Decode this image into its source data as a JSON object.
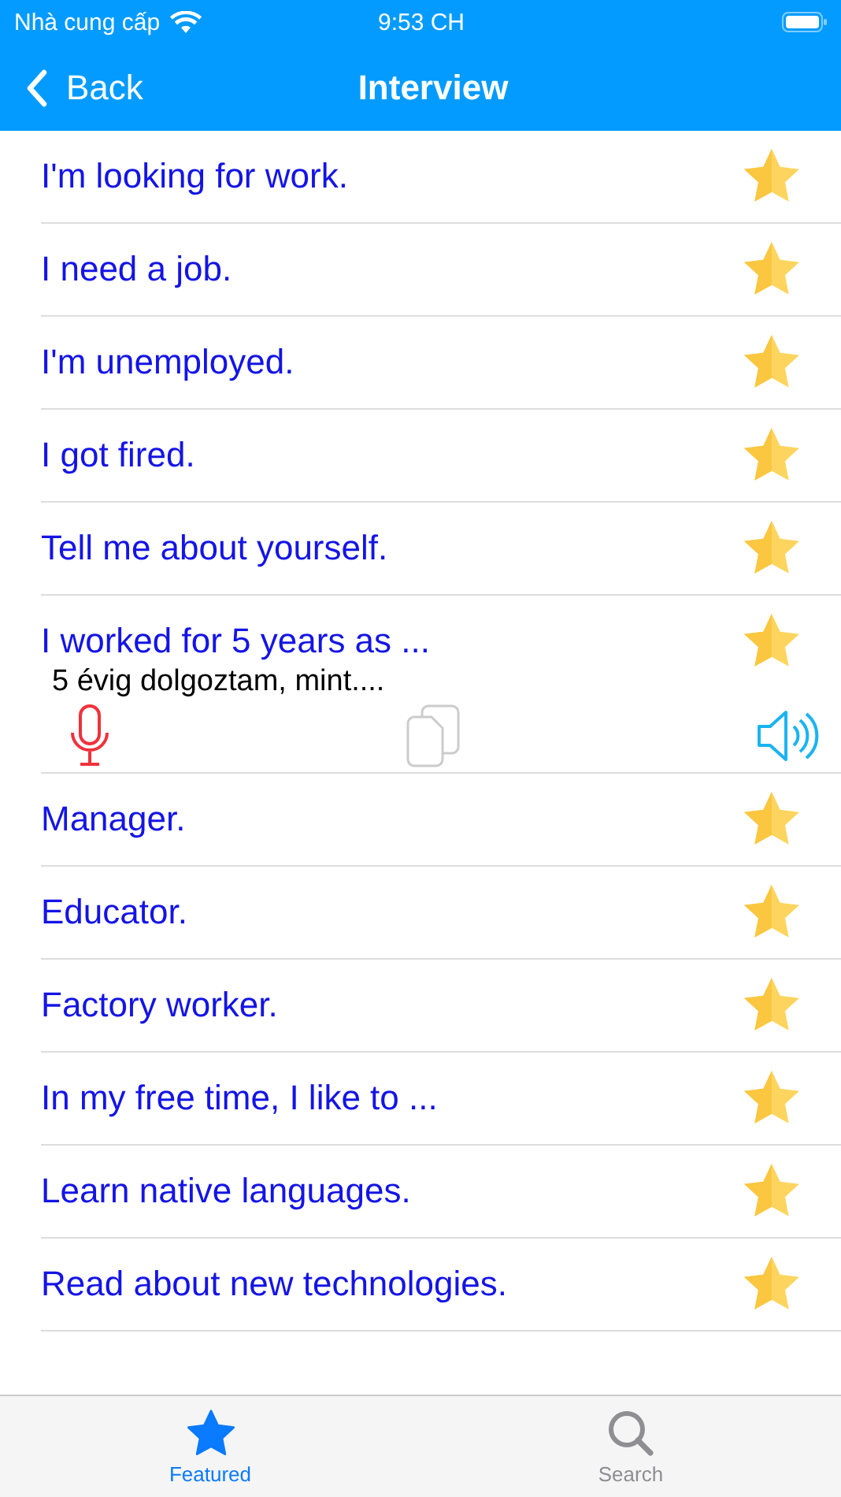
{
  "status_bar": {
    "carrier": "Nhà cung cấp",
    "time": "9:53 CH"
  },
  "nav": {
    "back": "Back",
    "title": "Interview"
  },
  "phrases": [
    {
      "text": "I'm looking for work.",
      "expanded": false
    },
    {
      "text": "I need a job.",
      "expanded": false
    },
    {
      "text": "I'm unemployed.",
      "expanded": false
    },
    {
      "text": "I got fired.",
      "expanded": false
    },
    {
      "text": "Tell me about yourself.",
      "expanded": false
    },
    {
      "text": "I worked for 5 years as ...",
      "expanded": true,
      "translation": "5 évig dolgoztam, mint...."
    },
    {
      "text": "Manager.",
      "expanded": false
    },
    {
      "text": "Educator.",
      "expanded": false
    },
    {
      "text": "Factory worker.",
      "expanded": false
    },
    {
      "text": "In my free time, I like to ...",
      "expanded": false
    },
    {
      "text": "Learn native languages.",
      "expanded": false
    },
    {
      "text": "Read about new technologies.",
      "expanded": false
    }
  ],
  "tabs": [
    {
      "label": "Featured",
      "selected": true
    },
    {
      "label": "Search",
      "selected": false
    }
  ]
}
